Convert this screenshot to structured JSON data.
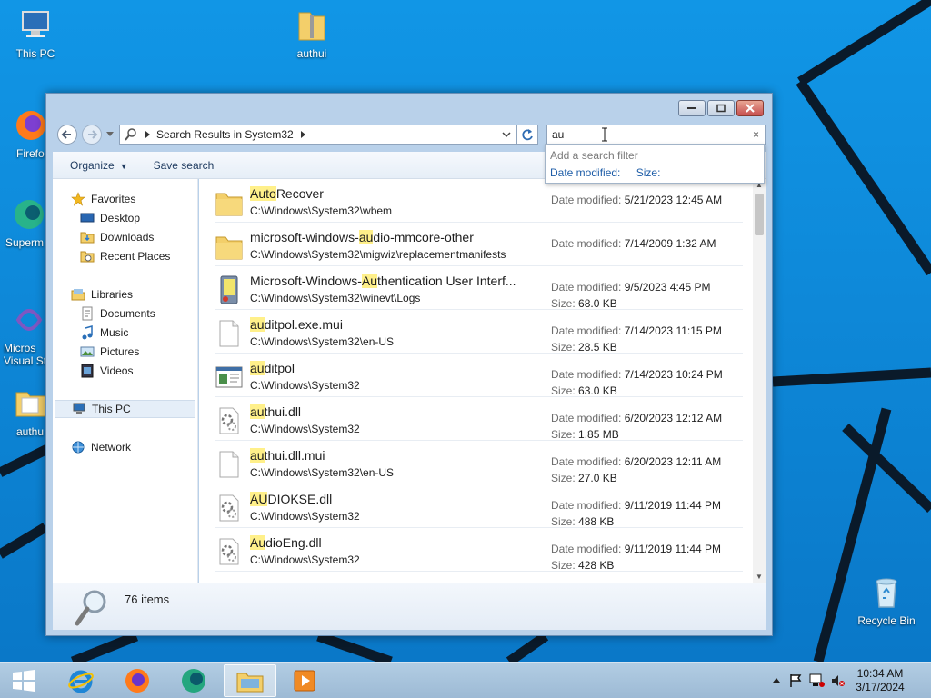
{
  "desktop": {
    "icons": [
      {
        "label": "This PC"
      },
      {
        "label": "authui"
      },
      {
        "label": "Firefo"
      },
      {
        "label": "Superm"
      },
      {
        "label": "Micros Visual St"
      },
      {
        "label": "authu"
      },
      {
        "label": "Recycle Bin"
      }
    ]
  },
  "window": {
    "address": {
      "breadcrumb": "Search Results in System32"
    },
    "search": {
      "value": "au",
      "clear_glyph": "×"
    },
    "search_dropdown": {
      "hint": "Add a search filter",
      "filters": [
        "Date modified:",
        "Size:"
      ]
    },
    "toolbar": {
      "organize": "Organize",
      "save_search": "Save search"
    },
    "nav": {
      "favorites": "Favorites",
      "desktop": "Desktop",
      "downloads": "Downloads",
      "recent": "Recent Places",
      "libraries": "Libraries",
      "documents": "Documents",
      "music": "Music",
      "pictures": "Pictures",
      "videos": "Videos",
      "this_pc": "This PC",
      "network": "Network"
    },
    "labels": {
      "date_modified": "Date modified:",
      "size": "Size:"
    },
    "results": [
      {
        "hl": "Auto",
        "rest": "Recover",
        "path": "C:\\Windows\\System32\\wbem",
        "date": "5/21/2023 12:45 AM",
        "size": "",
        "icon": "folder-icon"
      },
      {
        "pre": "microsoft-windows-",
        "hl": "au",
        "rest": "dio-mmcore-other",
        "path": "C:\\Windows\\System32\\migwiz\\replacementmanifests",
        "date": "7/14/2009 1:32 AM",
        "size": "",
        "icon": "folder-icon"
      },
      {
        "pre": "Microsoft-Windows-",
        "hl": "Au",
        "rest": "thentication User Interf...",
        "path": "C:\\Windows\\System32\\winevt\\Logs",
        "date": "9/5/2023 4:45 PM",
        "size": "68.0 KB",
        "icon": "event-log-icon"
      },
      {
        "hl": "au",
        "rest": "ditpol.exe.mui",
        "path": "C:\\Windows\\System32\\en-US",
        "date": "7/14/2023 11:15 PM",
        "size": "28.5 KB",
        "icon": "file-icon"
      },
      {
        "hl": "au",
        "rest": "ditpol",
        "path": "C:\\Windows\\System32",
        "date": "7/14/2023 10:24 PM",
        "size": "63.0 KB",
        "icon": "application-icon"
      },
      {
        "hl": "au",
        "rest": "thui.dll",
        "path": "C:\\Windows\\System32",
        "date": "6/20/2023 12:12 AM",
        "size": "1.85 MB",
        "icon": "dll-icon"
      },
      {
        "hl": "au",
        "rest": "thui.dll.mui",
        "path": "C:\\Windows\\System32\\en-US",
        "date": "6/20/2023 12:11 AM",
        "size": "27.0 KB",
        "icon": "file-icon"
      },
      {
        "hl": "AU",
        "rest": "DIOKSE.dll",
        "path": "C:\\Windows\\System32",
        "date": "9/11/2019 11:44 PM",
        "size": "488 KB",
        "icon": "dll-icon"
      },
      {
        "hl": "Au",
        "rest": "dioEng.dll",
        "path": "C:\\Windows\\System32",
        "date": "9/11/2019 11:44 PM",
        "size": "428 KB",
        "icon": "dll-icon"
      }
    ],
    "status": {
      "count": "76 items"
    }
  },
  "taskbar": {
    "clock_time": "10:34 AM",
    "clock_date": "3/17/2024"
  }
}
